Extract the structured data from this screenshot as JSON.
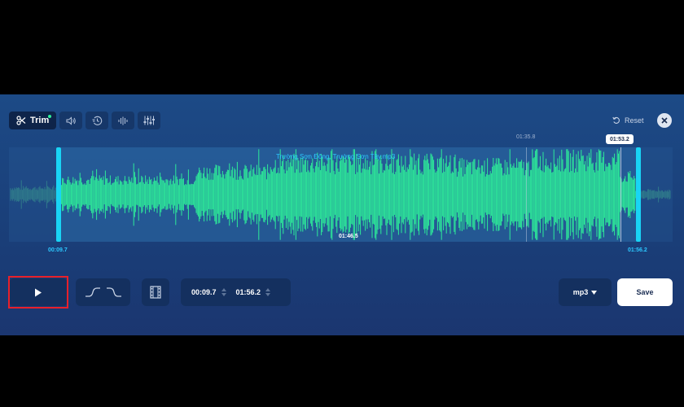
{
  "toolbar": {
    "trim_label": "Trim",
    "tools": [
      {
        "icon": "scissors-icon",
        "label": "Trim",
        "active": true
      },
      {
        "icon": "volume-icon"
      },
      {
        "icon": "speed-icon"
      },
      {
        "icon": "equalizer-waveform-icon"
      },
      {
        "icon": "mixer-sliders-icon"
      }
    ],
    "reset_label": "Reset"
  },
  "waveform": {
    "file_name": "Trường Sơn Đông, Trường Sơn Tây.mp3",
    "cursor_time": "01:35.8",
    "playhead_time": "01:53.2",
    "duration": "01:46.5",
    "start_time": "00:09.7",
    "end_time": "01:56.2",
    "wave_color": "#2ef29a",
    "handle_color": "#19d4f5"
  },
  "controls": {
    "start_value": "00:09.7",
    "end_value": "01:56.2",
    "format": "mp3",
    "save_label": "Save"
  }
}
